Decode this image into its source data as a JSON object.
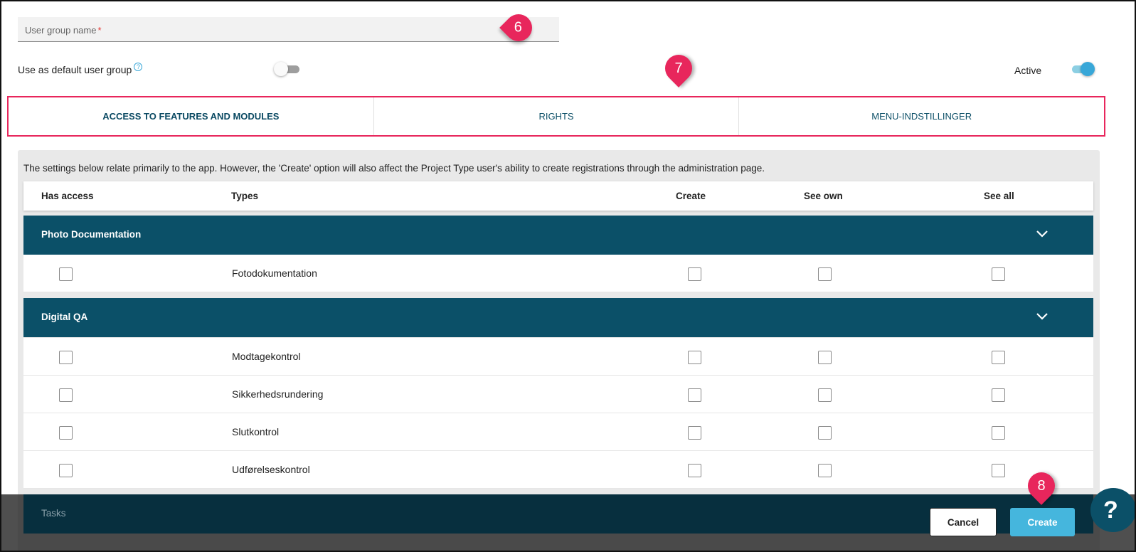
{
  "form": {
    "name_placeholder": "User group name",
    "required_mark": "*",
    "default_label": "Use as default user group",
    "help_icon": "?",
    "active_label": "Active",
    "default_toggle": "off",
    "active_toggle": "on"
  },
  "callouts": {
    "c6": "6",
    "c7": "7",
    "c8": "8"
  },
  "tabs": [
    {
      "label": "ACCESS TO FEATURES AND MODULES"
    },
    {
      "label": "RIGHTS"
    },
    {
      "label": "MENU-INDSTILLINGER"
    }
  ],
  "panel": {
    "intro": "The settings below relate primarily to the app. However, the 'Create' option will also affect the Project Type user's ability to create registrations through the administration page.",
    "columns": {
      "has_access": "Has access",
      "types": "Types",
      "create": "Create",
      "see_own": "See own",
      "see_all": "See all"
    },
    "groups": [
      {
        "title": "Photo Documentation",
        "rows": [
          "Fotodokumentation"
        ]
      },
      {
        "title": "Digital QA",
        "rows": [
          "Modtagekontrol",
          "Sikkerhedsrundering",
          "Slutkontrol",
          "Udførelseskontrol"
        ]
      }
    ]
  },
  "footer": {
    "tasks": "Tasks",
    "cancel": "Cancel",
    "create": "Create",
    "help_fab": "?"
  },
  "colors": {
    "accent": "#45b6dd",
    "header_bar": "#0b5068",
    "callout": "#e8265c"
  }
}
